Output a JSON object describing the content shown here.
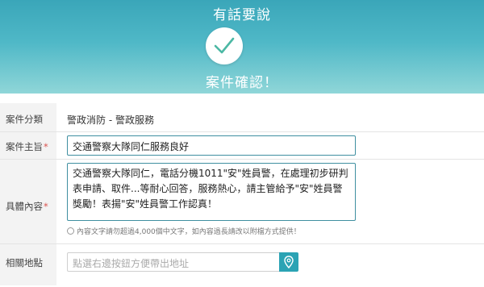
{
  "header": {
    "title": "有話要說",
    "subtitle": "案件確認！",
    "check_icon": "check-icon",
    "color_top": "#3aa6b9",
    "color_bottom": "#8fd6d8"
  },
  "form": {
    "category": {
      "label": "案件分類",
      "value": "警政消防 - 警政服務"
    },
    "subject": {
      "label": "案件主旨",
      "required_mark": "*",
      "value": "交通警察大隊同仁服務良好"
    },
    "content": {
      "label": "具體內容",
      "required_mark": "*",
      "value": "交通警察大隊同仁，電話分機1011\"安\"姓員警，在處理初步研判表申請、取件...等耐心回答，服務熱心，請主管給予\"安\"姓員警獎勵！表揚\"安\"姓員警工作認真！",
      "hint": "內容文字請勿超過4,000個中文字，如內容過長請改以附檔方式提供！",
      "hint_icon": "comment-icon"
    },
    "address": {
      "label": "相關地點",
      "placeholder": "點選右邊按鈕方便帶出地址",
      "button_icon": "map-pin-icon"
    },
    "accent_color": "#2ba3b4",
    "required_color": "#d9534f"
  }
}
